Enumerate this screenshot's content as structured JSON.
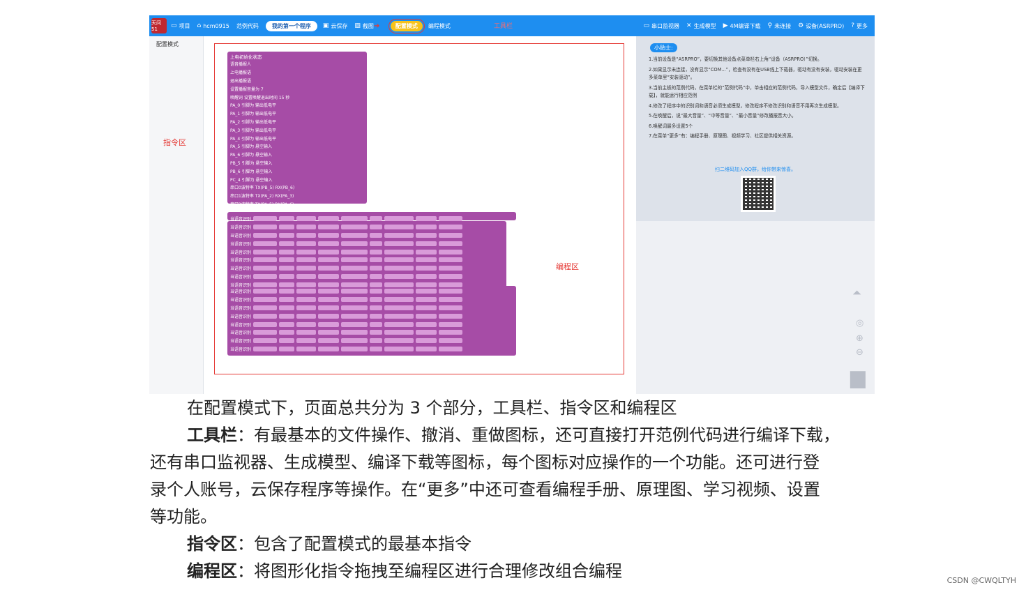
{
  "toolbar": {
    "logo": "天问51",
    "items_left": [
      {
        "icon": "folder-icon",
        "label": "项目"
      },
      {
        "icon": "home-icon",
        "label": "hcm0915"
      },
      {
        "icon": "",
        "label": "范例代码"
      }
    ],
    "program_name": "我的第一个程序",
    "items_mid": [
      {
        "icon": "save-icon",
        "label": "云保存"
      },
      {
        "icon": "screenshot-icon",
        "label": "截图"
      }
    ],
    "config_mode": "配置模式",
    "program_mode": "编程模式",
    "toolbar_label": "工具栏",
    "items_right": [
      {
        "icon": "monitor-icon",
        "label": "串口监视器"
      },
      {
        "icon": "model-icon",
        "label": "生成模型"
      },
      {
        "icon": "download-icon",
        "label": "4M编译下载"
      },
      {
        "icon": "link-icon",
        "label": "未连接"
      },
      {
        "icon": "gear-icon",
        "label": "设备(ASRPRO)"
      },
      {
        "icon": "help-icon",
        "label": "更多"
      }
    ]
  },
  "sidebar": {
    "tab": "配置模式"
  },
  "workspace": {
    "instruction_area_label": "指令区",
    "programming_area_label": "编程区",
    "init_block_title": "上电初始化状态",
    "init_rows": [
      "语音播报人",
      "上电播报语",
      "退出播报语",
      "设置播报音量为 7",
      "唤醒词 设置唤醒退出时间 15 秒",
      "PA_0 引脚为 输出低电平",
      "PA_1 引脚为 输出低电平",
      "PA_2 引脚为 输出低电平",
      "PA_3 引脚为 输出低电平",
      "PA_4 引脚为 输出低电平",
      "PA_5 引脚为 悬空输入",
      "PA_6 引脚为 悬空输入",
      "PB_5 引脚为 悬空输入",
      "PB_6 引脚为 悬空输入",
      "PC_4 引脚为 悬空输入",
      "串口0波特率 TX(PB_5) RX(PB_6)",
      "串口1波特率 TX(PA_2) RX(PA_3)",
      "串口2波特率 TX(PA_5) RX(PA_6)"
    ],
    "cmd_row_label": "当语音识别",
    "cmd_row_count": 17
  },
  "tips": {
    "title": "小贴士:",
    "items": [
      "1.当前设备是“ASRPRO”，要切换其他设备点菜单栏右上角“设备（ASRPRO）”切换。",
      "2.如果显示未连接，没有显示“COM...”，检查有没有在USB线上下载器，驱动有没有安装，驱动安装在更多菜单里“安装驱动”。",
      "3.当前主板的范例代码，在菜单栏的“范例代码”中，单击相应的范例代码，导入模型文件，确定后【编译下载】，就能运行相应范例",
      "4.修改了程序中的识别词和语音必须生成模型，修改程序不修改识别和语音不用再次生成模型。",
      "5.在唤醒后，说“最大音量”、“中等音量”、“最小音量”修改播报音大小。",
      "6.唤醒词最多设置5个",
      "7.在菜单“更多”有：编程手册、原理图、视频学习、社区提供相关资源。"
    ],
    "link": "扫二维码加入QQ群，给你带来惊喜。"
  },
  "doc": {
    "line1": "在配置模式下，页面总共分为 3 个部分，工具栏、指令区和编程区",
    "toolbar_head": "工具栏",
    "toolbar_body_1": "：有最基本的文件操作、撤消、重做图标，还可直接打开范例代码进行编译下载，",
    "toolbar_body_2": "还有串口监视器、生成模型、编译下载等图标，每个图标对应操作的一个功能。还可进行登",
    "toolbar_body_3": "录个人账号，云保存程序等操作。在“更多”中还可查看编程手册、原理图、学习视频、设置",
    "toolbar_body_4": "等功能。",
    "cmd_head": "指令区",
    "cmd_body": "：包含了配置模式的最基本指令",
    "prog_head": "编程区",
    "prog_body": "：将图形化指令拖拽至编程区进行合理修改组合编程"
  },
  "watermark": "CSDN @CWQLTYH"
}
